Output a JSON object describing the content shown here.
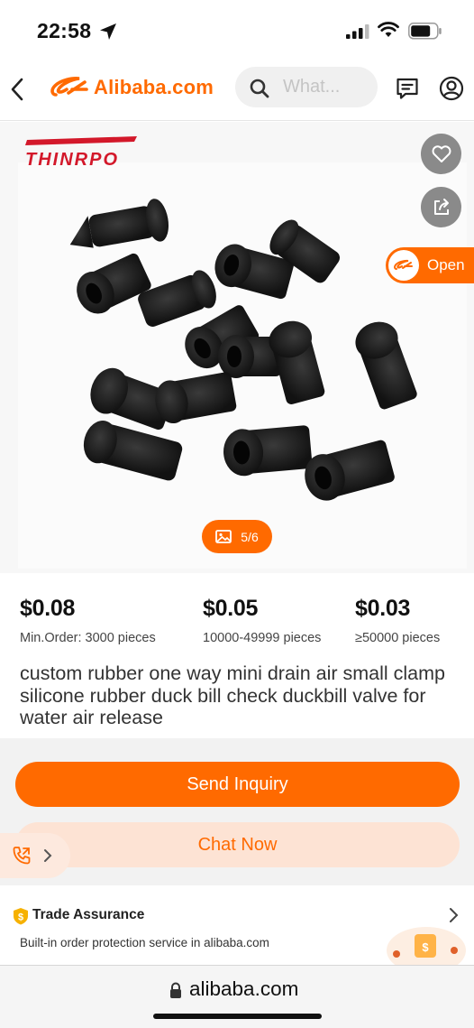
{
  "status_bar": {
    "time": "22:58"
  },
  "header": {
    "logo_text": "Alibaba.com",
    "search_placeholder": "What..."
  },
  "product": {
    "brand_logo_text": "THINRPO",
    "image_counter": "5/6",
    "open_label": "Open",
    "title": "custom rubber one way mini drain air small clamp silicone rubber duck bill check duckbill valve for water air release",
    "price_tiers": [
      {
        "price": "$0.08",
        "quantity": "Min.Order: 3000 pieces"
      },
      {
        "price": "$0.05",
        "quantity": "10000-49999 pieces"
      },
      {
        "price": "$0.03",
        "quantity": "≥50000 pieces"
      }
    ]
  },
  "actions": {
    "send_inquiry": "Send Inquiry",
    "chat_now": "Chat Now"
  },
  "trade_assurance": {
    "title": "Trade Assurance",
    "subtitle": "Built-in order protection service in alibaba.com"
  },
  "browser": {
    "url": "alibaba.com"
  },
  "colors": {
    "accent": "#ff6a00",
    "accent_light": "#fde3d4"
  }
}
